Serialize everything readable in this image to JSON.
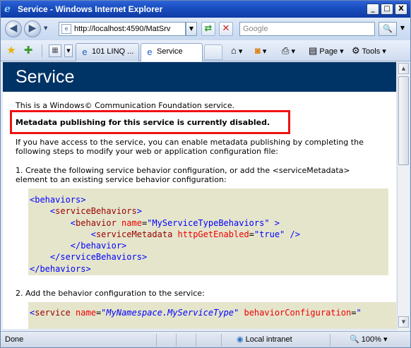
{
  "window": {
    "title": "Service - Windows Internet Explorer",
    "icon": "ie-icon",
    "controls": {
      "minimize": "_",
      "maximize": "□",
      "close": "X"
    }
  },
  "address_bar": {
    "url": "http://localhost:4590/MatSrv",
    "search_placeholder": "Google",
    "back_glyph": "◀",
    "forward_glyph": "▶",
    "refresh_glyph": "⇄",
    "stop_glyph": "✕",
    "search_glyph": "🔍"
  },
  "tabs": [
    {
      "label": "101 LINQ ...",
      "icon": "ie-page-icon",
      "active": false
    },
    {
      "label": "Service",
      "icon": "ie-page-icon",
      "active": true
    }
  ],
  "command_bar": {
    "page_label": "Page",
    "tools_label": "Tools",
    "home_icon": "home-icon",
    "feeds_icon": "rss-icon",
    "print_icon": "printer-icon",
    "favorites_icon": "star-icon",
    "add_favorites_icon": "add-favorite-icon"
  },
  "page": {
    "heading": "Service",
    "intro": "This is a Windows© Communication Foundation service.",
    "warning": "Metadata publishing for this service is currently disabled.",
    "para1_line1": "If you have access to the service, you can enable metadata publishing by completing the",
    "para1_line2": "following steps to modify your web or application configuration file:",
    "step1_line1": "1. Create the following service behavior configuration, or add the <serviceMetadata>",
    "step1_line2": "element to an existing service behavior configuration:",
    "code1": {
      "l1_tag": "<behaviors>",
      "l2_open": "<",
      "l2_name": "serviceBehaviors",
      "l2_close": ">",
      "l3_open": "<",
      "l3_name": "behavior",
      "l3_attr": " name",
      "l3_eq": "=",
      "l3_val": "\"MyServiceTypeBehaviors\"",
      "l3_close": " >",
      "l4_open": "<",
      "l4_name": "serviceMetadata",
      "l4_attr": " httpGetEnabled",
      "l4_eq": "=",
      "l4_val": "\"true\"",
      "l4_close": " />",
      "l5": "</behavior>",
      "l6": "</serviceBehaviors>",
      "l7": "</behaviors>"
    },
    "step2": "2. Add the behavior configuration to the service:",
    "code2": {
      "open": "<",
      "name": "service",
      "attr1": " name",
      "eq1": "=",
      "val1": "\"MyNamespace.MyServiceType\"",
      "attr2": " behaviorConfiguration",
      "eq2": "=",
      "val2_start": "\""
    }
  },
  "status_bar": {
    "status": "Done",
    "zone": "Local intranet",
    "zoom": "100%"
  }
}
